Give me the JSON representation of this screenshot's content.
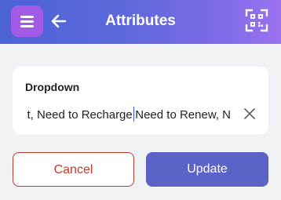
{
  "header": {
    "title": "Attributes",
    "menu_icon": "hamburger-menu-icon",
    "back_icon": "arrow-left-icon",
    "scan_icon": "qr-scan-icon",
    "gradient_start": "#4d63d6",
    "gradient_end": "#9b72f0",
    "menu_button_color": "#a25be8"
  },
  "field": {
    "label": "Dropdown",
    "value_before_cursor": "t, Need to Recharge",
    "value_after_cursor": "Need to Renew, N",
    "clear_icon": "close-icon"
  },
  "actions": {
    "cancel_label": "Cancel",
    "update_label": "Update",
    "cancel_color": "#c0392b",
    "update_color": "#5b63c6"
  }
}
